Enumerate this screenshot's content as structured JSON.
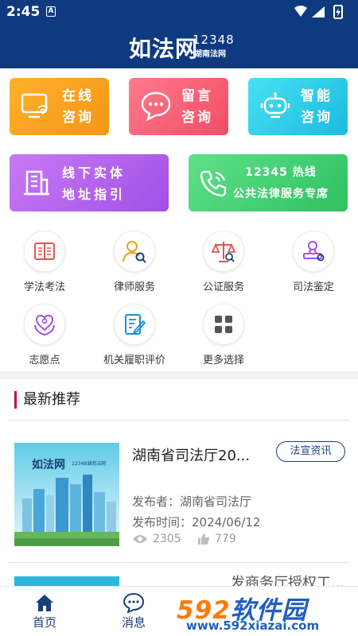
{
  "status_bar": {
    "time": "2:45",
    "notification_icon": "A"
  },
  "header": {
    "logo_text": "如法网",
    "logo_number": "12348",
    "logo_sub": "湖南法网"
  },
  "cards": [
    {
      "line1": "在线",
      "line2": "咨询",
      "icon": "computer-wifi-icon"
    },
    {
      "line1": "留言",
      "line2": "咨询",
      "icon": "chat-bubble-icon"
    },
    {
      "line1": "智能",
      "line2": "咨询",
      "icon": "robot-icon"
    },
    {
      "line1": "线下实体",
      "line2": "地址指引",
      "icon": "building-icon"
    },
    {
      "line1": "12345 热线",
      "line2": "公共法律服务专席",
      "icon": "phone-icon"
    }
  ],
  "services": [
    {
      "label": "学法考法",
      "icon": "book-icon"
    },
    {
      "label": "律师服务",
      "icon": "lawyer-icon"
    },
    {
      "label": "公证服务",
      "icon": "scales-icon"
    },
    {
      "label": "司法鉴定",
      "icon": "seal-icon"
    },
    {
      "label": "志愿点",
      "icon": "heart-hands-icon"
    },
    {
      "label": "机关履职评价",
      "icon": "edit-document-icon"
    },
    {
      "label": "更多选择",
      "icon": "grid-icon"
    }
  ],
  "section": {
    "title": "最新推荐"
  },
  "news": [
    {
      "title": "湖南省司法厅20...",
      "tag": "法宣资讯",
      "publisher": "发布者：湖南省司法厅",
      "time": "发布时间：2024/06/12",
      "views": "2305",
      "likes": "779",
      "thumb_logo": "如法网",
      "thumb_caption": "12348湖南法网"
    },
    {
      "title": "发商务厅授权工..."
    }
  ],
  "tabbar": {
    "home": "首页",
    "messages": "消息"
  },
  "watermark": {
    "brand_num": "592",
    "brand_text": "软件园",
    "url": "www.592xiazai.com"
  },
  "colors": {
    "header_bg": "#0f3a80",
    "accent_red": "#c8102e",
    "tab_active": "#1b3f7a"
  }
}
